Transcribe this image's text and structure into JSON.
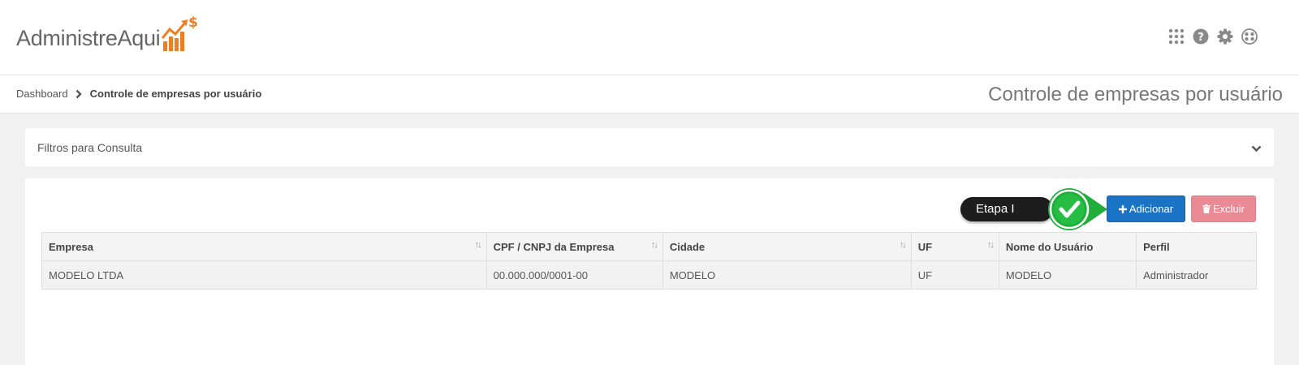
{
  "brand": {
    "name": "AdministreAqui",
    "accent": "#f07d1f"
  },
  "header": {
    "icons": [
      "apps-grid-icon",
      "help-icon",
      "settings-gear-icon",
      "user-menu-icon"
    ]
  },
  "breadcrumb": {
    "home": "Dashboard",
    "current": "Controle de empresas por usuário"
  },
  "page_title": "Controle de empresas por usuário",
  "filters": {
    "label": "Filtros para Consulta"
  },
  "actions": {
    "add_label": "Adicionar",
    "delete_label": "Excluir",
    "add_color": "#1a73c4",
    "delete_color": "#ea8a95"
  },
  "callout": {
    "label": "Etapa I",
    "badge_color": "#22b33c"
  },
  "table": {
    "columns": [
      {
        "label": "Empresa",
        "sortable": true
      },
      {
        "label": "CPF / CNPJ da Empresa",
        "sortable": true
      },
      {
        "label": "Cidade",
        "sortable": true
      },
      {
        "label": "UF",
        "sortable": true
      },
      {
        "label": "Nome do Usuário",
        "sortable": false
      },
      {
        "label": "Perfil",
        "sortable": false
      }
    ],
    "rows": [
      [
        "MODELO LTDA",
        "00.000.000/0001-00",
        "MODELO",
        "UF",
        "MODELO",
        "Administrador"
      ]
    ]
  }
}
